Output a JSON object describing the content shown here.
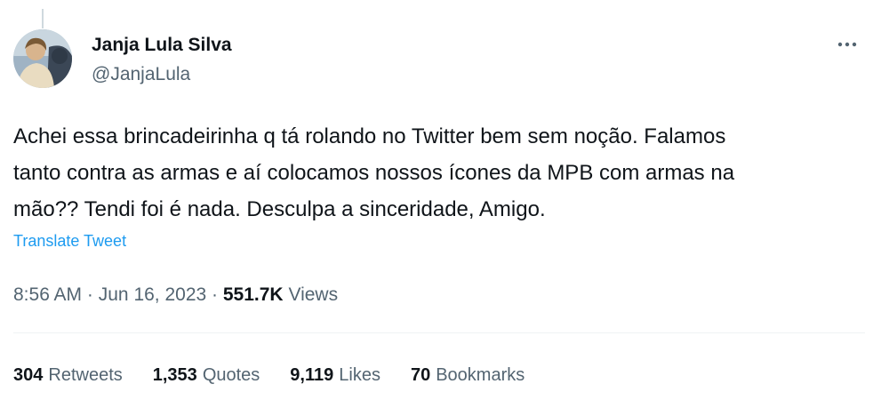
{
  "user": {
    "display_name": "Janja Lula Silva",
    "handle": "@JanjaLula"
  },
  "tweet": {
    "text": "Achei essa brincadeirinha q tá rolando no Twitter bem sem noção. Falamos\ntanto contra as armas e aí colocamos nossos ícones da MPB com armas na\nmão?? Tendi foi é nada. Desculpa a sinceridade, Amigo.",
    "translate_label": "Translate Tweet",
    "time": "8:56 AM",
    "separator": "·",
    "date": "Jun 16, 2023",
    "views_count": "551.7K",
    "views_label": "Views"
  },
  "stats": {
    "retweets_count": "304",
    "retweets_label": "Retweets",
    "quotes_count": "1,353",
    "quotes_label": "Quotes",
    "likes_count": "9,119",
    "likes_label": "Likes",
    "bookmarks_count": "70",
    "bookmarks_label": "Bookmarks"
  },
  "icons": {
    "more": "more-dots-icon"
  },
  "colors": {
    "text_primary": "#0f1419",
    "text_secondary": "#536471",
    "link": "#1d9bf0",
    "divider": "#eff3f4"
  }
}
